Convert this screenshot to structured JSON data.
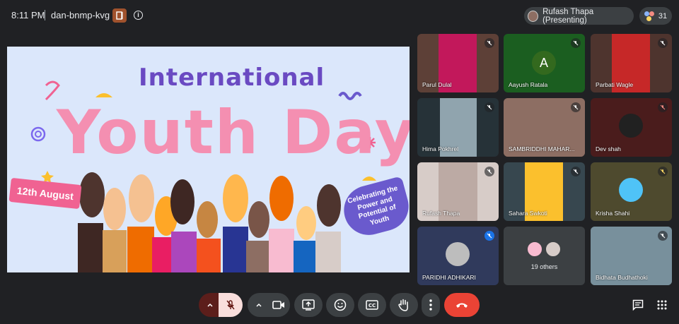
{
  "header": {
    "time": "8:11 PM",
    "meeting_code": "dan-bnmp-kvg",
    "presenter_label": "Rufash Thapa (Presenting)",
    "participant_count": "31"
  },
  "slide": {
    "title_line1": "International",
    "title_line2": "Youth Day",
    "date_label": "12th August",
    "tagline": "Celebrating the Power and Potential of Youth"
  },
  "tiles": [
    {
      "name": "Parul Dulal"
    },
    {
      "name": "Aayush Ratala",
      "initial": "A"
    },
    {
      "name": "Parbati Wagle"
    },
    {
      "name": "Hima Pokhrel"
    },
    {
      "name": "SAMBRIDDHI MAHAR..."
    },
    {
      "name": "Dev shah"
    },
    {
      "name": "Rufash Thapa"
    },
    {
      "name": "Sahara Swkoti"
    },
    {
      "name": "Krisha Shahi"
    },
    {
      "name": "PARIDHI ADHIKARI"
    },
    {
      "name": "19 others"
    },
    {
      "name": "Bidhata Budhathoki"
    }
  ],
  "colors": {
    "background": "#202124",
    "tile": "#3c4043",
    "end_call": "#ea4335",
    "mic_off": "#f9dedc",
    "speaking": "#1a73e8"
  },
  "icons": [
    "door-icon",
    "info-icon",
    "mic-off-icon",
    "chevron-up-icon",
    "camera-icon",
    "present-icon",
    "emoji-icon",
    "captions-icon",
    "raise-hand-icon",
    "more-icon",
    "end-call-icon",
    "chat-icon",
    "activities-icon"
  ]
}
